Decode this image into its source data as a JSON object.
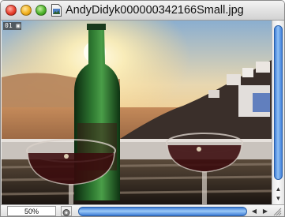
{
  "window": {
    "title": "AndyDidyk000000342166Small.jpg"
  },
  "canvas": {
    "badge_text": "01"
  },
  "statusbar": {
    "zoom_value": "50%"
  },
  "icons": [
    "close-icon",
    "minimize-icon",
    "zoom-icon",
    "document-icon",
    "navigator-icon",
    "scroll-up-icon",
    "scroll-down-icon",
    "scroll-left-icon",
    "scroll-right-icon",
    "resize-grip-icon"
  ],
  "colors": {
    "scroll_thumb": "#3f7ed8",
    "titlebar": "#d2d2d2",
    "sky_top": "#7fa6c9",
    "sun": "#fff6c8",
    "wine": "#3a0a0c",
    "bottle_glass": "#1f5a24"
  }
}
